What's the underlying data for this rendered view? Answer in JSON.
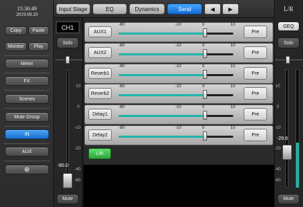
{
  "clock": {
    "time": "15:36:49",
    "date": "2019.08.20"
  },
  "sidebar": {
    "copy": "Copy",
    "paste": "Paste",
    "monitor": "Monitor",
    "play": "Play",
    "meter": "Meter",
    "fx": "FX",
    "scenes": "Scenes",
    "mute_group": "Mute Group",
    "in": "IN",
    "aux": "AUX"
  },
  "tabs": [
    {
      "label": "Input Stage"
    },
    {
      "label": "EQ"
    },
    {
      "label": "Dynamics"
    },
    {
      "label": "Send",
      "active": true
    }
  ],
  "channel": {
    "name": "CH1",
    "solo": "Solo",
    "mute": "Mute",
    "fader_value": "-80.0",
    "fader_level": 0.0,
    "scale": [
      "10",
      "0",
      "-10",
      "-20",
      "-40",
      "-60"
    ]
  },
  "output": {
    "name": "L/R",
    "geq": "GEQ",
    "solo": "Solo",
    "mute": "Mute",
    "fader_value": "-29.8",
    "meter_level": 0.38,
    "scale": [
      "10",
      "0",
      "-10",
      "-20",
      "-40",
      "-60"
    ]
  },
  "send_scale": [
    "-80",
    "-10",
    "0",
    "10"
  ],
  "sends": [
    {
      "name": "AUX1",
      "pre": "Pre",
      "level": 0.0
    },
    {
      "name": "AUX2",
      "pre": "Pre",
      "level": 0.0
    },
    {
      "name": "Reverb1",
      "pre": "Pre",
      "level": 0.0
    },
    {
      "name": "Reverb2",
      "pre": "Pre",
      "level": 0.0
    },
    {
      "name": "Delay1",
      "pre": "Pre",
      "level": 0.0
    },
    {
      "name": "Delay2",
      "pre": "Pre",
      "level": 0.0
    }
  ],
  "lr_button": "L/R",
  "colors": {
    "accent": "#1f7fe0",
    "send_fill": "#1fb5aa",
    "lr_green": "#3cc34c"
  },
  "icons": {
    "prev": "◀",
    "next": "▶",
    "target": "⊕"
  }
}
